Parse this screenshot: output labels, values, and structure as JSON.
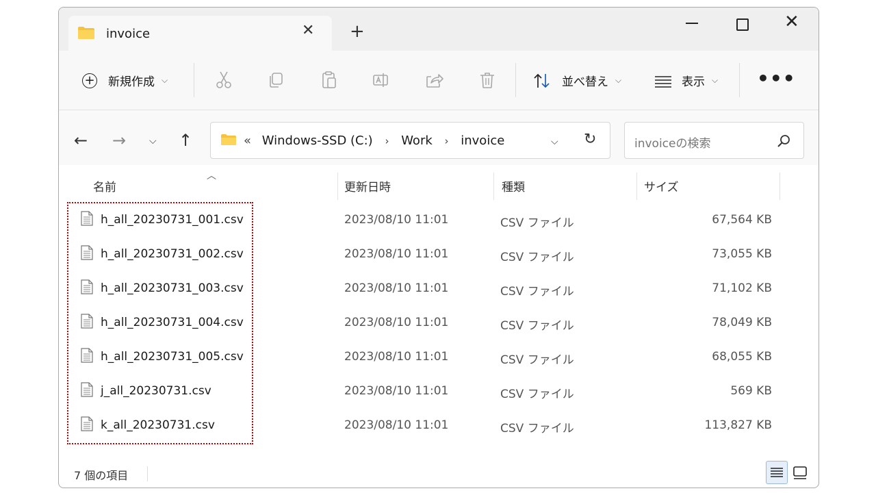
{
  "window": {
    "tab_title": "invoice",
    "new_tab_label": "+"
  },
  "commandbar": {
    "new_label": "新規作成",
    "sort_label": "並べ替え",
    "view_label": "表示",
    "more_label": "•••"
  },
  "navigation": {
    "breadcrumb": [
      "Windows-SSD (C:)",
      "Work",
      "invoice"
    ],
    "search_placeholder": "invoiceの検索"
  },
  "columns": {
    "name": "名前",
    "date": "更新日時",
    "type": "種類",
    "size": "サイズ"
  },
  "files": [
    {
      "name": "h_all_20230731_001.csv",
      "date": "2023/08/10 11:01",
      "type": "CSV ファイル",
      "size": "67,564 KB"
    },
    {
      "name": "h_all_20230731_002.csv",
      "date": "2023/08/10 11:01",
      "type": "CSV ファイル",
      "size": "73,055 KB"
    },
    {
      "name": "h_all_20230731_003.csv",
      "date": "2023/08/10 11:01",
      "type": "CSV ファイル",
      "size": "71,102 KB"
    },
    {
      "name": "h_all_20230731_004.csv",
      "date": "2023/08/10 11:01",
      "type": "CSV ファイル",
      "size": "78,049 KB"
    },
    {
      "name": "h_all_20230731_005.csv",
      "date": "2023/08/10 11:01",
      "type": "CSV ファイル",
      "size": "68,055 KB"
    },
    {
      "name": "j_all_20230731.csv",
      "date": "2023/08/10 11:01",
      "type": "CSV ファイル",
      "size": "569 KB"
    },
    {
      "name": "k_all_20230731.csv",
      "date": "2023/08/10 11:01",
      "type": "CSV ファイル",
      "size": "113,827 KB"
    }
  ],
  "status": {
    "item_count": "7 個の項目"
  },
  "colors": {
    "folder": "#f5c342",
    "highlight_border": "#c00000",
    "title_bar": "#efefef"
  }
}
